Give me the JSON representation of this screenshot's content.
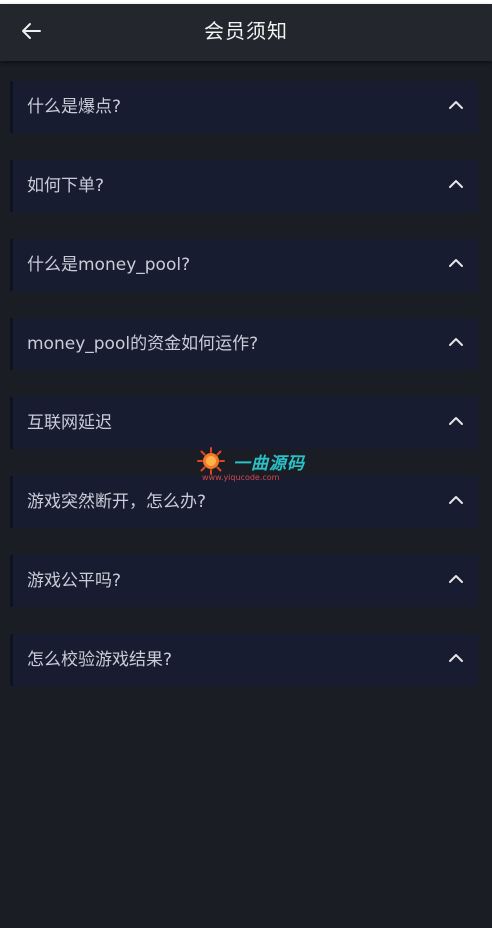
{
  "header": {
    "title": "会员须知"
  },
  "faq": [
    {
      "question": "什么是爆点?"
    },
    {
      "question": "如何下单?"
    },
    {
      "question": "什么是money_pool?"
    },
    {
      "question": "money_pool的资金如何运作?"
    },
    {
      "question": "互联网延迟"
    },
    {
      "question": "游戏突然断开，怎么办?"
    },
    {
      "question": "游戏公平吗?"
    },
    {
      "question": "怎么校验游戏结果?"
    }
  ],
  "watermark": {
    "title": "一曲源码",
    "url": "www.yiqucode.com"
  },
  "icons": {
    "back": "arrow-left-icon",
    "expand": "chevron-up-icon"
  },
  "colors": {
    "background": "#1a1d24",
    "header": "#24262d",
    "card": "#171c30",
    "text": "#c9cdd8"
  }
}
